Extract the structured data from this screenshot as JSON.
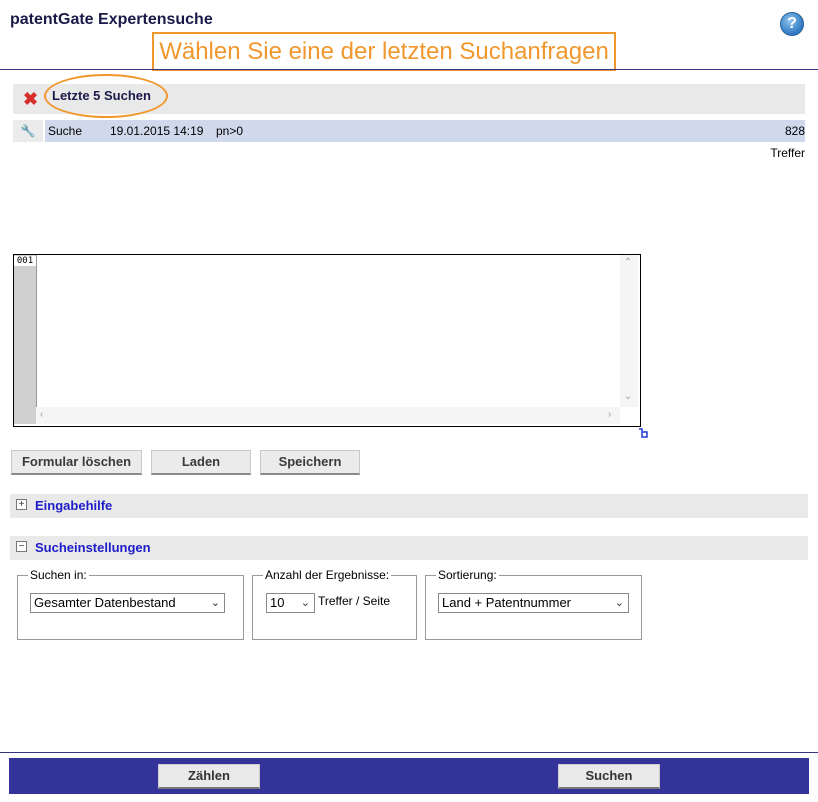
{
  "header": {
    "title": "patentGate Expertensuche",
    "help_symbol": "?"
  },
  "callout": "Wählen Sie eine der letzten Suchanfragen",
  "recent": {
    "title": "Letzte 5 Suchen",
    "close_symbol": "✖",
    "wrench_symbol": "🔧",
    "rows": [
      {
        "type": "Suche",
        "date": "19.01.2015 14:19",
        "query": "pn>0",
        "hits": "828 Treffer"
      }
    ]
  },
  "editor": {
    "line_number": "001"
  },
  "buttons": {
    "clear": "Formular löschen",
    "load": "Laden",
    "save": "Speichern"
  },
  "sections": {
    "help": {
      "label": "Eingabehilfe",
      "toggle": "+"
    },
    "settings": {
      "label": "Sucheinstellungen",
      "toggle": "−"
    }
  },
  "settings": {
    "search_in": {
      "legend": "Suchen in:",
      "selected": "Gesamter Datenbestand"
    },
    "result_count": {
      "legend": "Anzahl der Ergebnisse:",
      "selected": "10",
      "suffix": "Treffer / Seite"
    },
    "sorting": {
      "legend": "Sortierung:",
      "selected": "Land + Patentnummer"
    }
  },
  "footer": {
    "count_button": "Zählen",
    "search_button": "Suchen"
  },
  "icons": [
    "help-icon",
    "close-icon",
    "wrench-icon",
    "plus-icon",
    "minus-icon",
    "chevron-down-icon",
    "resize-icon"
  ],
  "colors": {
    "accent": "#f0982e",
    "navy": "#333399",
    "link": "#1d1dc9",
    "row": "#cfd9eb"
  }
}
